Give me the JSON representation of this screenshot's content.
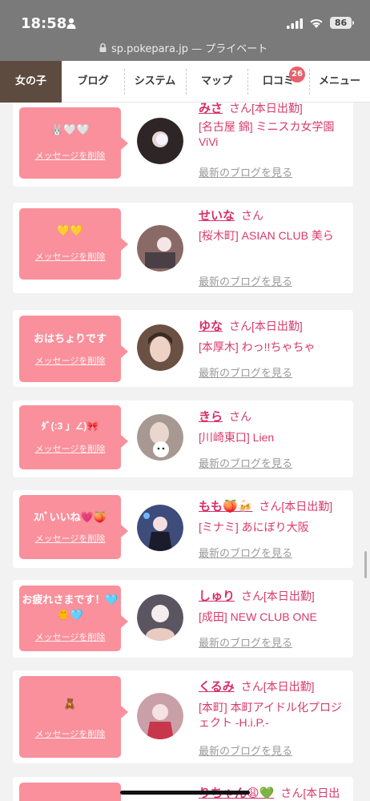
{
  "status_bar": {
    "time": "18:58",
    "battery": "86"
  },
  "url_bar": {
    "url": "sp.pokepara.jp",
    "suffix": " — プライベート"
  },
  "nav": {
    "tabs": [
      {
        "label": "女の子"
      },
      {
        "label": "ブログ"
      },
      {
        "label": "システム"
      },
      {
        "label": "マップ"
      },
      {
        "label": "口コミ",
        "badge": "26"
      },
      {
        "label": "メニュー"
      }
    ]
  },
  "common": {
    "delete_label": "メッセージを削除",
    "blog_link": "最新のブログを見る",
    "san": "さん"
  },
  "cards": [
    {
      "message": "🐰🤍🤍",
      "name": "みさ",
      "status": "[本日出勤]",
      "shop": "[名古屋 錦] ミニスカ女学園ViVi",
      "avatar_color": "#2d2526"
    },
    {
      "message": "💛💛",
      "name": "せいな",
      "status": "",
      "shop": "[桜木町] ASIAN CLUB 美ら",
      "avatar_color": "#8a6a66"
    },
    {
      "message": "おはちょりです",
      "name": "ゆな",
      "status": "[本日出勤]",
      "shop": "[本厚木] わっ!!ちゃちゃ",
      "avatar_color": "#6b5044"
    },
    {
      "message": "ﾀﾞ(:3 」∠)🎀",
      "name": "きら",
      "status": "",
      "shop": "[川崎東口] Lien",
      "avatar_color": "#a79892"
    },
    {
      "message": "ｽﾊﾞいいね💗🍑",
      "name": "もも🍑🍻",
      "status": "[本日出勤]",
      "shop": "[ミナミ] あにぼり大阪",
      "avatar_color": "#3d4c7a"
    },
    {
      "message": "お疲れさまです！🩵🐥🩵",
      "name": "しゅり",
      "status": "[本日出勤]",
      "shop": "[成田] NEW CLUB ONE",
      "avatar_color": "#5a5560"
    },
    {
      "message": "🧸",
      "name": "くるみ",
      "status": "[本日出勤]",
      "shop": "[本町] 本町アイドル化プロジェクト -H.i.P.-",
      "avatar_color": "#c9a0a8"
    },
    {
      "message": "",
      "name": "りちゃん😩💚",
      "status": "[本日出",
      "shop": "",
      "avatar_color": "#c9a0a8"
    }
  ]
}
